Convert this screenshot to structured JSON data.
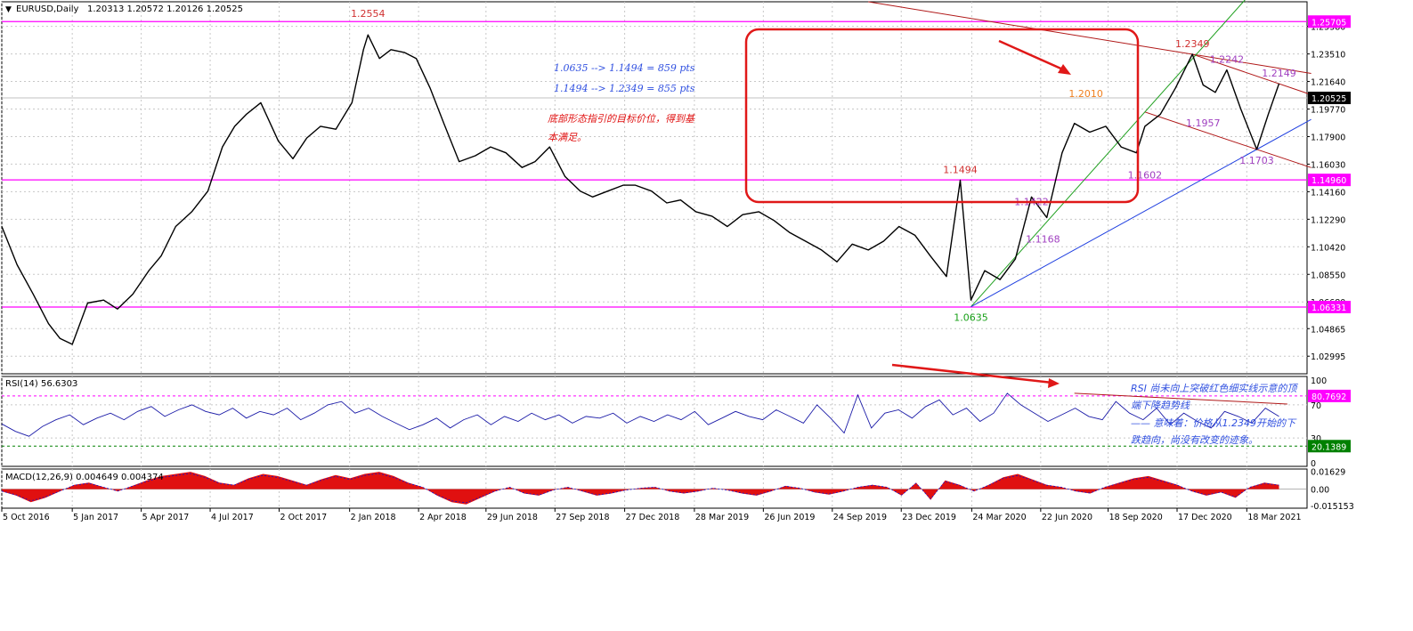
{
  "chart_data": {
    "type": "line",
    "window": {
      "symbol_info": "EURUSD,Daily",
      "ohlc_text": "1.20313 1.20572 1.20126 1.20525"
    },
    "price_panel": {
      "y_range": [
        1.018,
        1.2705
      ],
      "y_ticks": [
        "1.25380",
        "1.23510",
        "1.21640",
        "1.19770",
        "1.17900",
        "1.16030",
        "1.14160",
        "1.12290",
        "1.10420",
        "1.08550",
        "1.06680",
        "1.04865",
        "1.02995"
      ],
      "current_price": "1.20525",
      "horizontal_levels": [
        {
          "price": 1.25705,
          "label": "1.25705"
        },
        {
          "price": 1.1496,
          "label": "1.14960"
        },
        {
          "price": 1.06331,
          "label": "1.06331"
        }
      ],
      "series": [
        {
          "x": [
            "2016-10-05",
            "2016-10-25",
            "2016-11-15",
            "2016-12-05",
            "2016-12-20",
            "2017-01-05",
            "2017-01-25",
            "2017-02-15",
            "2017-03-05",
            "2017-03-25",
            "2017-04-15",
            "2017-05-01",
            "2017-05-20",
            "2017-06-10",
            "2017-07-01",
            "2017-07-20",
            "2017-08-05",
            "2017-08-20",
            "2017-09-08",
            "2017-10-01",
            "2017-10-20",
            "2017-11-07",
            "2017-11-25",
            "2017-12-15",
            "2018-01-05",
            "2018-01-20",
            "2018-01-26",
            "2018-02-10",
            "2018-02-25",
            "2018-03-15",
            "2018-03-30",
            "2018-04-17",
            "2018-05-05",
            "2018-05-25",
            "2018-06-15",
            "2018-07-05",
            "2018-07-25",
            "2018-08-15",
            "2018-09-01",
            "2018-09-20",
            "2018-10-10",
            "2018-10-30",
            "2018-11-15",
            "2018-12-05",
            "2018-12-25",
            "2019-01-10",
            "2019-01-31",
            "2019-02-20",
            "2019-03-10",
            "2019-03-30",
            "2019-04-20",
            "2019-05-10",
            "2019-05-30",
            "2019-06-20",
            "2019-07-10",
            "2019-07-30",
            "2019-08-20",
            "2019-09-10",
            "2019-09-30",
            "2019-10-20",
            "2019-11-10",
            "2019-11-30",
            "2019-12-20",
            "2020-01-10",
            "2020-01-30",
            "2020-02-20",
            "2020-03-09",
            "2020-03-23",
            "2020-04-10",
            "2020-04-30",
            "2020-05-20",
            "2020-06-10",
            "2020-06-30",
            "2020-07-20",
            "2020-08-05",
            "2020-08-25",
            "2020-09-15",
            "2020-10-05",
            "2020-10-25",
            "2020-11-05",
            "2020-11-25",
            "2020-12-15",
            "2021-01-06",
            "2021-01-20",
            "2021-02-05",
            "2021-02-20",
            "2021-03-10",
            "2021-03-31",
            "2021-04-15",
            "2021-04-29"
          ],
          "y": [
            1.118,
            1.092,
            1.072,
            1.052,
            1.042,
            1.038,
            1.066,
            1.068,
            1.062,
            1.072,
            1.088,
            1.098,
            1.118,
            1.128,
            1.142,
            1.172,
            1.186,
            1.194,
            1.202,
            1.176,
            1.164,
            1.178,
            1.186,
            1.184,
            1.202,
            1.238,
            1.248,
            1.232,
            1.238,
            1.236,
            1.232,
            1.212,
            1.188,
            1.162,
            1.166,
            1.172,
            1.168,
            1.158,
            1.162,
            1.172,
            1.152,
            1.142,
            1.138,
            1.142,
            1.146,
            1.146,
            1.142,
            1.134,
            1.136,
            1.128,
            1.125,
            1.118,
            1.126,
            1.128,
            1.122,
            1.114,
            1.108,
            1.102,
            1.094,
            1.106,
            1.102,
            1.108,
            1.118,
            1.112,
            1.098,
            1.084,
            1.1494,
            1.068,
            1.088,
            1.082,
            1.096,
            1.138,
            1.124,
            1.168,
            1.188,
            1.182,
            1.186,
            1.172,
            1.168,
            1.186,
            1.194,
            1.212,
            1.2349,
            1.214,
            1.209,
            1.2242,
            1.198,
            1.1703,
            1.194,
            1.2149
          ]
        }
      ],
      "point_labels": [
        {
          "text": "1.2554",
          "date": "2018-01-26",
          "price": 1.2554,
          "color": "#d03030"
        },
        {
          "text": "1.1494",
          "date": "2020-03-09",
          "price": 1.1494,
          "color": "#d03030"
        },
        {
          "text": "1.0635",
          "date": "2020-03-23",
          "price": 1.0635,
          "color": "#18a018"
        },
        {
          "text": "1.1422",
          "date": "2020-06-10",
          "price": 1.1422,
          "color": "#a040c0"
        },
        {
          "text": "1.1168",
          "date": "2020-06-25",
          "price": 1.1168,
          "color": "#a040c0"
        },
        {
          "text": "1.2010",
          "date": "2020-08-20",
          "price": 1.201,
          "color": "#f08020"
        },
        {
          "text": "1.1602",
          "date": "2020-11-05",
          "price": 1.1602,
          "color": "#a040c0"
        },
        {
          "text": "1.2349",
          "date": "2021-01-06",
          "price": 1.2349,
          "color": "#d03030"
        },
        {
          "text": "1.2242",
          "date": "2021-02-20",
          "price": 1.2242,
          "color": "#a040c0"
        },
        {
          "text": "1.1957",
          "date": "2021-01-20",
          "price": 1.1957,
          "color": "#a040c0"
        },
        {
          "text": "1.2149",
          "date": "2021-04-29",
          "price": 1.2149,
          "color": "#a040c0"
        },
        {
          "text": "1.1703",
          "date": "2021-03-31",
          "price": 1.1703,
          "color": "#a040c0"
        }
      ],
      "annotations": {
        "move_1": "1.0635 --> 1.1494 = 859 pts",
        "move_2": "1.1494 --> 1.2349 = 855 pts",
        "note_target_line1": "底部形态指引的目标价位，得到基",
        "note_target_line2": "本满足。"
      }
    },
    "rsi_panel": {
      "title": "RSI(14) 56.6303",
      "y_range": [
        0,
        100
      ],
      "y_ticks": [
        "100",
        "70",
        "30",
        "0"
      ],
      "levels": [
        {
          "value": 80.7692,
          "label": "80.7692"
        },
        {
          "value": 20.1389,
          "label": "20.1389"
        }
      ],
      "series": [
        {
          "values": [
            47,
            38,
            32,
            44,
            52,
            58,
            46,
            54,
            60,
            52,
            62,
            68,
            56,
            64,
            70,
            62,
            58,
            66,
            54,
            62,
            58,
            66,
            52,
            60,
            70,
            74,
            60,
            66,
            56,
            48,
            40,
            46,
            54,
            42,
            52,
            58,
            46,
            56,
            50,
            60,
            52,
            58,
            48,
            56,
            54,
            60,
            48,
            56,
            50,
            58,
            52,
            62,
            46,
            54,
            62,
            56,
            52,
            64,
            56,
            48,
            70,
            54,
            36,
            82,
            42,
            60,
            64,
            54,
            68,
            76,
            58,
            66,
            50,
            60,
            84,
            70,
            60,
            50,
            58,
            66,
            56,
            52,
            74,
            60,
            52,
            66,
            46,
            60,
            50,
            42,
            62,
            56,
            48,
            66,
            56
          ]
        }
      ],
      "notes": {
        "line1": "RSI 尚未向上突破红色细实线示意的顶",
        "line2": "端下降趋势线",
        "line3": "—— 意味着：价格从1.2349开始的下",
        "line4": "跌趋向，尚没有改变的迹象。"
      }
    },
    "macd_panel": {
      "title": "MACD(12,26,9) 0.004649 0.004374",
      "y_ticks": [
        "0.01629",
        "0.00",
        "-0.015153"
      ],
      "y_range": [
        -0.0175,
        0.0185
      ],
      "series": [
        {
          "values": [
            -0.002,
            -0.006,
            -0.012,
            -0.008,
            -0.002,
            0.004,
            0.006,
            0.002,
            -0.002,
            0.003,
            0.008,
            0.012,
            0.014,
            0.016,
            0.012,
            0.006,
            0.004,
            0.01,
            0.014,
            0.012,
            0.008,
            0.004,
            0.009,
            0.013,
            0.01,
            0.014,
            0.016,
            0.012,
            0.006,
            0.002,
            -0.006,
            -0.012,
            -0.014,
            -0.008,
            -0.002,
            0.002,
            -0.004,
            -0.006,
            -0.001,
            0.002,
            -0.002,
            -0.006,
            -0.004,
            -0.001,
            0.001,
            0.002,
            -0.002,
            -0.004,
            -0.002,
            0.001,
            -0.001,
            -0.004,
            -0.006,
            -0.002,
            0.003,
            0.001,
            -0.003,
            -0.005,
            -0.002,
            0.002,
            0.004,
            0.002,
            -0.006,
            0.006,
            -0.01,
            0.008,
            0.004,
            -0.002,
            0.004,
            0.011,
            0.014,
            0.009,
            0.004,
            0.002,
            -0.002,
            -0.004,
            0.002,
            0.006,
            0.01,
            0.012,
            0.008,
            0.004,
            -0.002,
            -0.006,
            -0.003,
            -0.008,
            0.002,
            0.006,
            0.004
          ]
        }
      ]
    },
    "x_axis": {
      "labels": [
        "5 Oct 2016",
        "5 Jan 2017",
        "5 Apr 2017",
        "4 Jul 2017",
        "2 Oct 2017",
        "2 Jan 2018",
        "2 Apr 2018",
        "29 Jun 2018",
        "27 Sep 2018",
        "27 Dec 2018",
        "28 Mar 2019",
        "26 Jun 2019",
        "24 Sep 2019",
        "23 Dec 2019",
        "24 Mar 2020",
        "22 Jun 2020",
        "18 Sep 2020",
        "17 Dec 2020",
        "18 Mar 2021"
      ],
      "label_dates": [
        "2016-10-05",
        "2017-01-05",
        "2017-04-05",
        "2017-07-04",
        "2017-10-02",
        "2018-01-02",
        "2018-04-02",
        "2018-06-29",
        "2018-09-27",
        "2018-12-27",
        "2019-03-28",
        "2019-06-26",
        "2019-09-24",
        "2019-12-23",
        "2020-03-24",
        "2020-06-22",
        "2020-09-18",
        "2020-12-17",
        "2021-03-18"
      ]
    },
    "grid": true,
    "colors": {
      "price_line": "#000000",
      "level_line": "#ff00ff",
      "level_badge": "#ff00ff",
      "current_badge": "#000000",
      "rsi_line": "#1c1ca8",
      "rsi_oversold_badge": "#008000",
      "macd_hist": "#e01010",
      "signal_line": "#1010d0",
      "channel_line": "#b01818",
      "green_trend": "#20a020",
      "blue_trend": "#2040e0",
      "highlight_box": "#e01818",
      "annotation_blue": "#3050e0",
      "annotation_red": "#e01010"
    }
  }
}
